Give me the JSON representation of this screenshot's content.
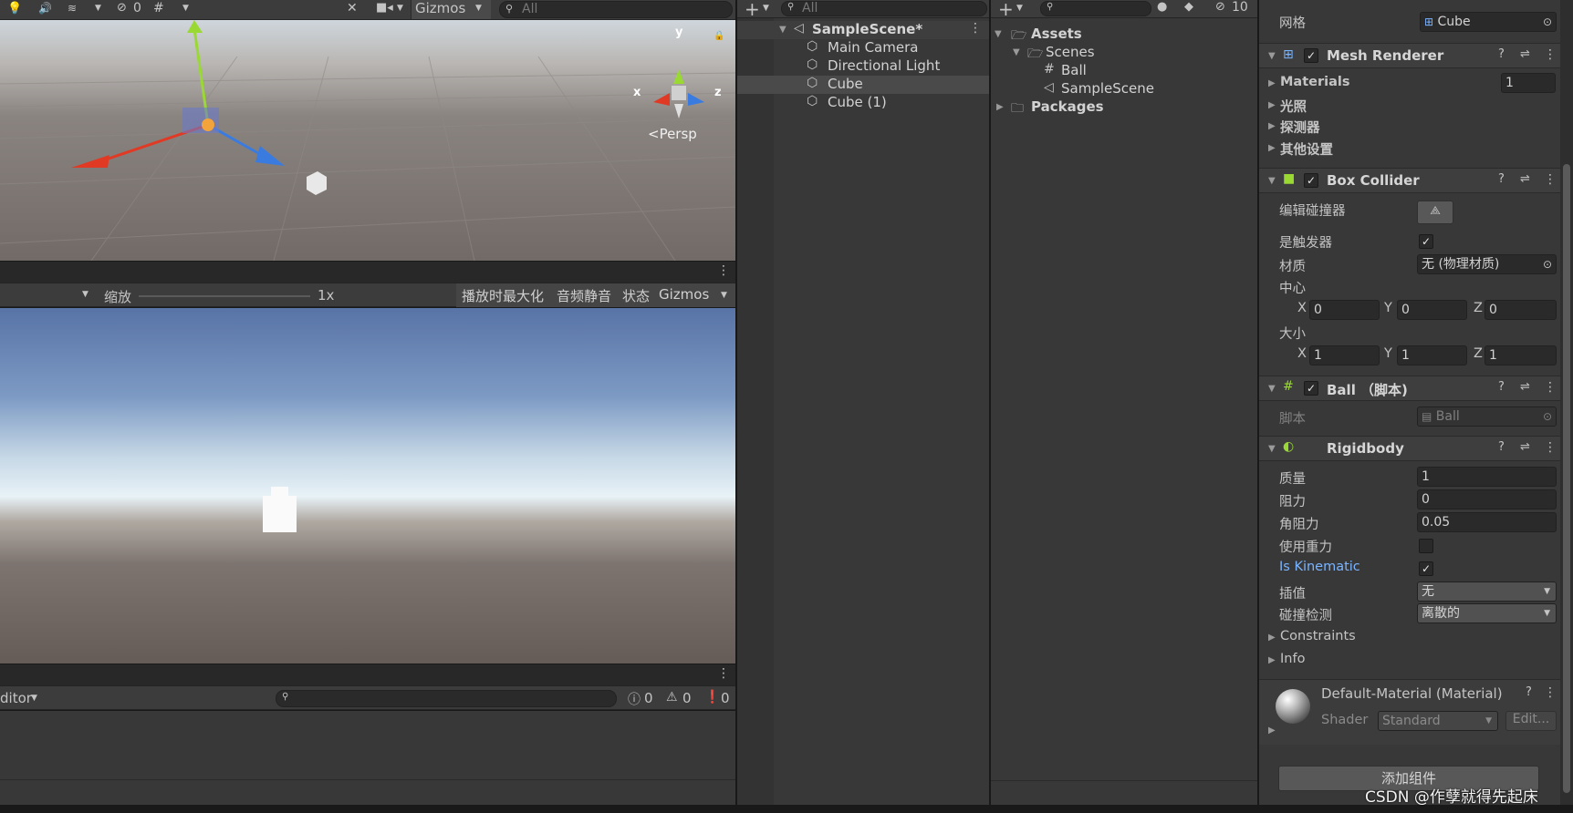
{
  "scene_toolbar": {
    "hidden_count": "0",
    "gizmos": "Gizmos",
    "search_placeholder": "All"
  },
  "scene_view": {
    "persp_label": "<Persp",
    "axis_x": "x",
    "axis_y": "y",
    "axis_z": "z"
  },
  "game_toolbar": {
    "scale_label": "缩放",
    "scale_value": "1x",
    "maximize": "播放时最大化",
    "mute": "音频静音",
    "stats": "状态",
    "gizmos": "Gizmos"
  },
  "console": {
    "editor_label": "ditor",
    "info_count": "0",
    "warn_count": "0",
    "error_count": "0"
  },
  "hierarchy": {
    "search_placeholder": "All",
    "scene_name": "SampleScene*",
    "items": [
      {
        "label": "Main Camera"
      },
      {
        "label": "Directional Light"
      },
      {
        "label": "Cube"
      },
      {
        "label": "Cube (1)"
      }
    ]
  },
  "project": {
    "hidden_count": "10",
    "assets": "Assets",
    "scenes": "Scenes",
    "ball": "Ball",
    "sample_scene": "SampleScene",
    "packages": "Packages"
  },
  "inspector": {
    "mesh_label": "网格",
    "mesh_value": "Cube",
    "mesh_renderer": {
      "title": "Mesh Renderer",
      "materials": "Materials",
      "materials_count": "1",
      "lighting": "光照",
      "probes": "探测器",
      "other": "其他设置"
    },
    "box_collider": {
      "title": "Box Collider",
      "edit": "编辑碰撞器",
      "is_trigger": "是触发器",
      "material": "材质",
      "material_value": "无 (物理材质)",
      "center": "中心",
      "size": "大小",
      "cx": "0",
      "cy": "0",
      "cz": "0",
      "sx": "1",
      "sy": "1",
      "sz": "1",
      "x": "X",
      "y": "Y",
      "z": "Z"
    },
    "ball_script": {
      "title": "Ball （脚本)",
      "script_label": "脚本",
      "script_value": "Ball"
    },
    "rigidbody": {
      "title": "Rigidbody",
      "mass": "质量",
      "mass_value": "1",
      "drag": "阻力",
      "drag_value": "0",
      "angular_drag": "角阻力",
      "angular_drag_value": "0.05",
      "use_gravity": "使用重力",
      "is_kinematic": "Is Kinematic",
      "interpolate": "插值",
      "interpolate_value": "无",
      "collision": "碰撞检测",
      "collision_value": "离散的",
      "constraints": "Constraints",
      "info": "Info"
    },
    "material": {
      "title": "Default-Material (Material)",
      "shader_label": "Shader",
      "shader_value": "Standard",
      "edit": "Edit..."
    },
    "add_component": "添加组件"
  },
  "watermark": "CSDN @作孽就得先起床",
  "colors": {
    "accent_blue": "#7ab4ff",
    "panel": "#383838",
    "field": "#2a2a2a"
  }
}
